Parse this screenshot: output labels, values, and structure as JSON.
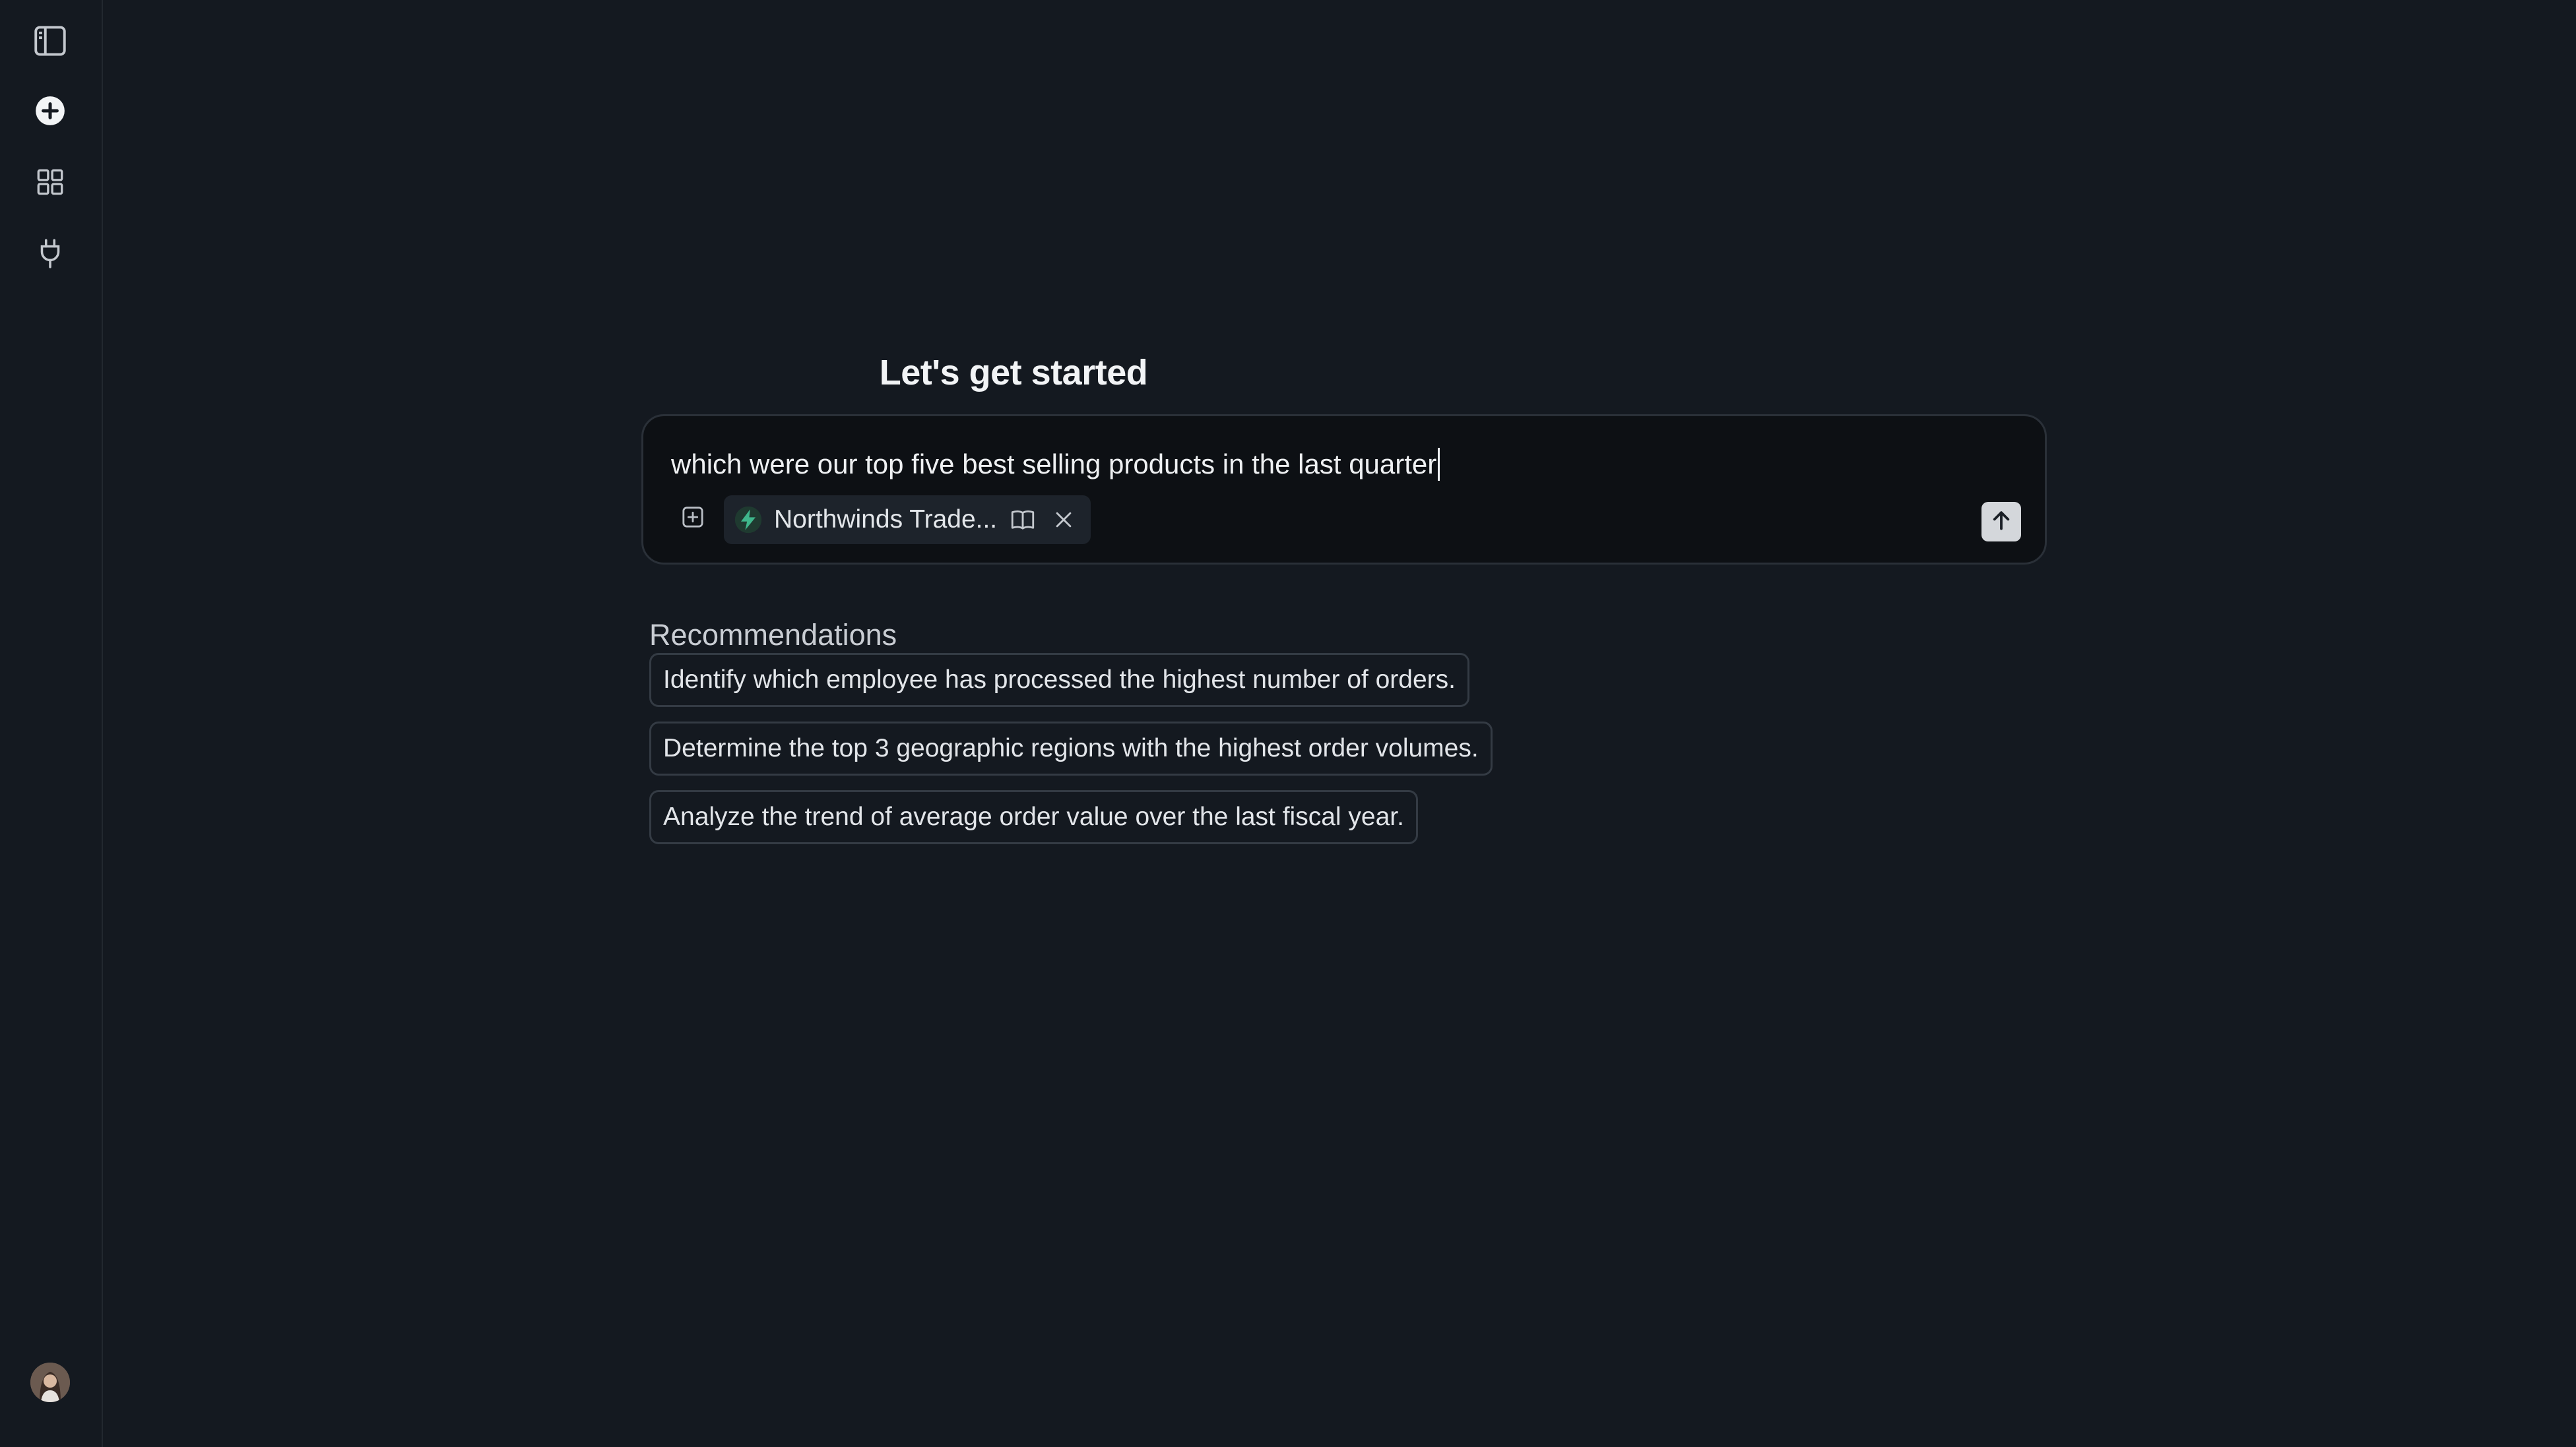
{
  "sidebar": {
    "items": [
      {
        "name": "toggle-sidebar",
        "icon": "sidebar-panel-icon"
      },
      {
        "name": "new-chat",
        "icon": "plus-circle-icon"
      },
      {
        "name": "apps",
        "icon": "grid-icon"
      },
      {
        "name": "connectors",
        "icon": "plug-icon"
      }
    ],
    "avatar_icon": "user-avatar"
  },
  "main": {
    "headline": "Let's get started",
    "composer": {
      "value": "which were our top five best selling products in the last quarter",
      "attach_icon": "attach-plus-square-icon",
      "source": {
        "label": "Northwinds Trade...",
        "icon": "bolt-icon",
        "icon_color": "#3fb68b",
        "book_icon": "book-icon",
        "remove_icon": "close-icon"
      },
      "send_icon": "arrow-up-icon"
    },
    "recommendations": {
      "title": "Recommendations",
      "items": [
        "Identify which employee has processed the highest number of orders.",
        "Determine the top 3 geographic regions with the highest order volumes.",
        "Analyze the trend of average order value over the last fiscal year."
      ]
    }
  },
  "colors": {
    "background": "#141920",
    "composer_bg": "#0d1014",
    "border": "#2a3038",
    "send_button": "#d4d7db"
  }
}
